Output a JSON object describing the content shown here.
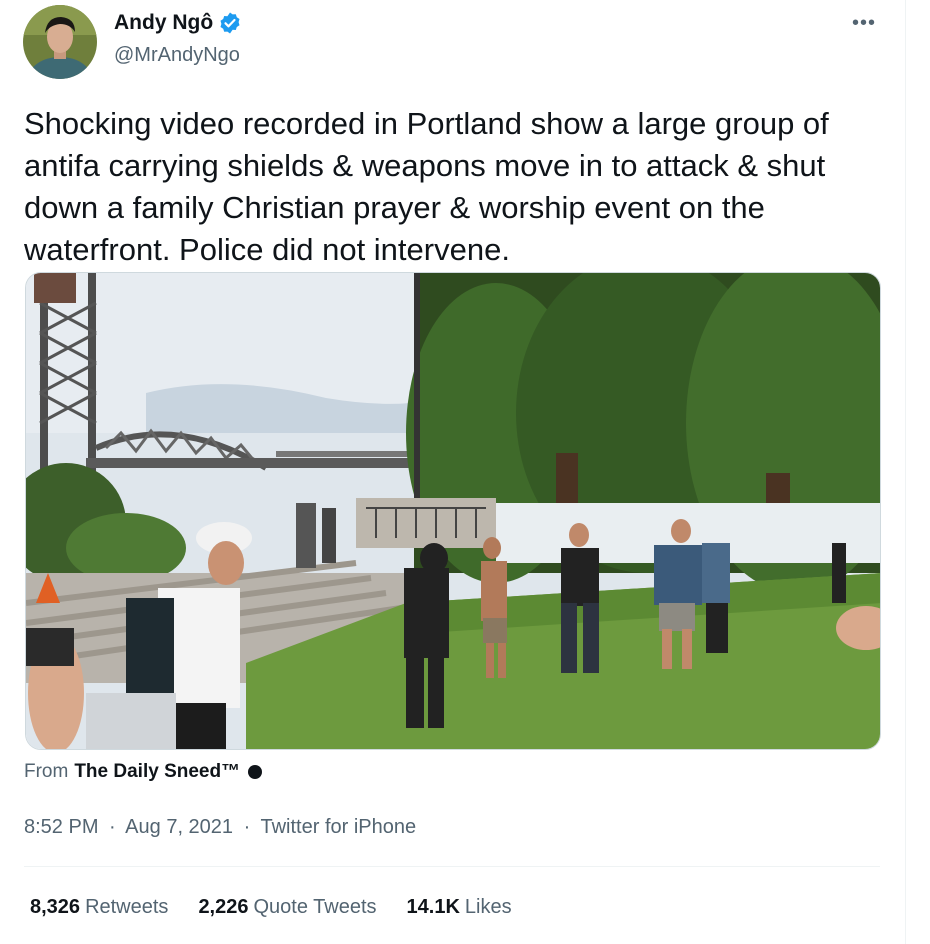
{
  "author": {
    "name": "Andy Ngô",
    "handle": "@MrAndyNgo",
    "verified_icon": "verified-badge-icon",
    "more_glyph": "•••"
  },
  "tweet": {
    "text": "Shocking video recorded in Portland show a large group of antifa carrying shields & weapons move in to attack & shut down a family Christian prayer & worship event on the waterfront. Police did not intervene."
  },
  "media": {
    "type": "video-thumbnail"
  },
  "source": {
    "prefix": "From",
    "name": "The Daily Sneed™"
  },
  "meta": {
    "time": "8:52 PM",
    "separator": "·",
    "date": "Aug 7, 2021",
    "client": "Twitter for iPhone"
  },
  "stats": {
    "retweets": {
      "count": "8,326",
      "label": "Retweets"
    },
    "quotes": {
      "count": "2,226",
      "label": "Quote Tweets"
    },
    "likes": {
      "count": "14.1K",
      "label": "Likes"
    }
  },
  "colors": {
    "text": "#0f1419",
    "secondary": "#536471",
    "verified": "#1d9bf0",
    "border": "#cfd9de"
  }
}
